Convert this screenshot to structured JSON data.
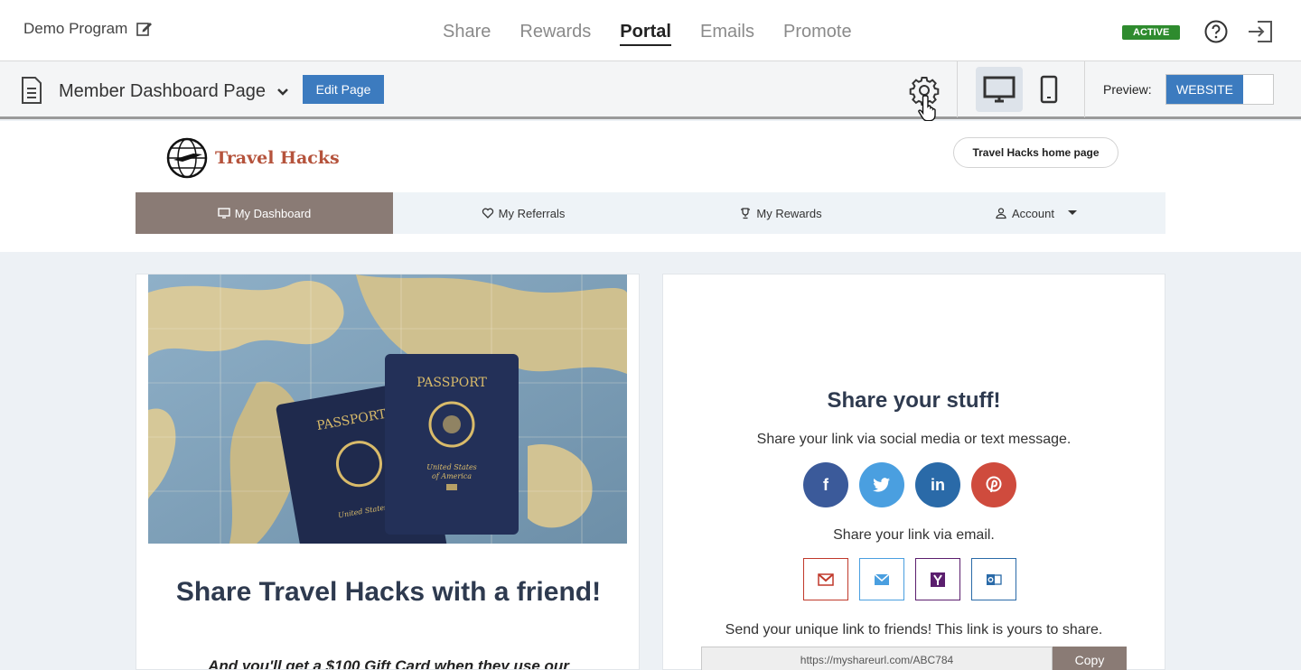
{
  "header": {
    "program_name": "Demo Program",
    "nav": [
      {
        "label": "Share",
        "active": false
      },
      {
        "label": "Rewards",
        "active": false
      },
      {
        "label": "Portal",
        "active": true
      },
      {
        "label": "Emails",
        "active": false
      },
      {
        "label": "Promote",
        "active": false
      }
    ],
    "status_badge": "ACTIVE",
    "accent": "#3c7bbf",
    "active_color": "#2e8b2e"
  },
  "toolbar": {
    "page_name": "Member Dashboard Page",
    "edit_label": "Edit Page",
    "preview_label": "Preview:",
    "preview_mode": "WEBSITE"
  },
  "site": {
    "brand": "Travel Hacks",
    "home_link": "Travel Hacks home page",
    "tabs": [
      {
        "label": "My Dashboard",
        "icon": "monitor-icon",
        "active": true
      },
      {
        "label": "My Referrals",
        "icon": "heart-icon",
        "active": false
      },
      {
        "label": "My Rewards",
        "icon": "trophy-icon",
        "active": false
      },
      {
        "label": "Account",
        "icon": "user-icon",
        "active": false
      }
    ]
  },
  "hero": {
    "passport_front": "PASSPORT",
    "passport_back": "PASSPORT",
    "country_line1": "United States",
    "country_line2": "of America",
    "title": "Share Travel Hacks with a friend!",
    "subtitle": "And you'll get a $100 Gift Card when they use our"
  },
  "share": {
    "title": "Share your stuff!",
    "social_text": "Share your link via social media or text message.",
    "socials": [
      {
        "name": "facebook",
        "glyph": "f",
        "color": "#3b5a9a"
      },
      {
        "name": "twitter",
        "glyph": "🐦",
        "color": "#4a9fe0"
      },
      {
        "name": "linkedin",
        "glyph": "in",
        "color": "#2a6aa8"
      },
      {
        "name": "pinterest",
        "glyph": "P",
        "color": "#cf4b3d"
      }
    ],
    "email_text": "Share your link via email.",
    "link_text": "Send your unique link to friends! This link is yours to share.",
    "url": "https://myshareurl.com/ABC784",
    "copy_label": "Copy"
  }
}
